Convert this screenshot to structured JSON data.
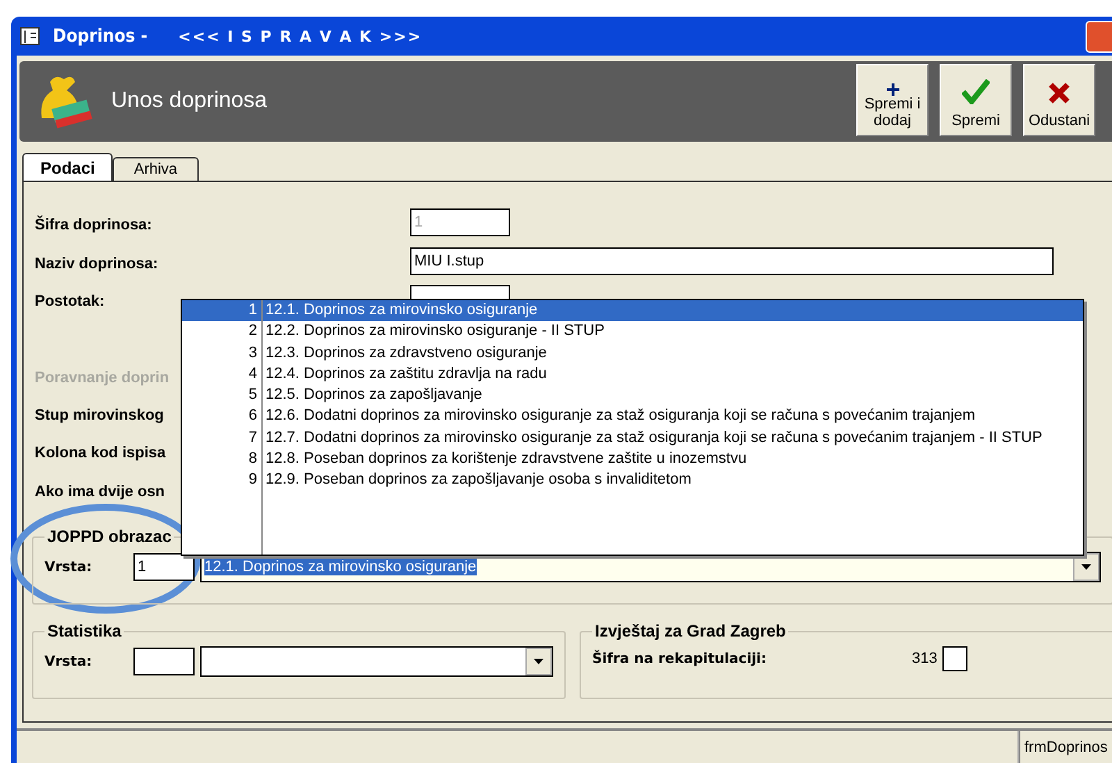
{
  "window": {
    "title": "Doprinos -",
    "mode": "<<< I S P R A V A K >>>"
  },
  "header": {
    "title": "Unos doprinosa"
  },
  "toolbar": [
    {
      "kind": "add",
      "label": "Spremi i",
      "label2": "dodaj"
    },
    {
      "kind": "save",
      "label": "Spremi"
    },
    {
      "kind": "cancel",
      "label": "Odustani"
    }
  ],
  "tabs": [
    {
      "label": "Podaci",
      "selected": true
    },
    {
      "label": "Arhiva",
      "selected": false
    }
  ],
  "fields": [
    {
      "label": "Šifra doprinosa:",
      "kind": "short",
      "value": "1",
      "disabled": true
    },
    {
      "label": "Naziv doprinosa:",
      "kind": "long",
      "value": "MIU I.stup",
      "disabled": false
    },
    {
      "label": "Postotak:",
      "kind": "short"
    },
    {
      "label": "Poravnanje doprin",
      "kind": "label",
      "disabled": true
    },
    {
      "label": "Stup mirovinskog",
      "kind": "label",
      "disabled": false
    },
    {
      "label": "Kolona kod ispisa",
      "kind": "label",
      "disabled": false
    },
    {
      "label": "Ako ima dvije osn",
      "kind": "label",
      "disabled": false
    }
  ],
  "dropdown_list": [
    {
      "number": "1",
      "text": "12.1. Doprinos za mirovinsko osiguranje",
      "selected": true
    },
    {
      "number": "2",
      "text": "12.2. Doprinos za mirovinsko osiguranje - II STUP",
      "selected": false
    },
    {
      "number": "3",
      "text": "12.3. Doprinos za zdravstveno osiguranje",
      "selected": false
    },
    {
      "number": "4",
      "text": "12.4. Doprinos za zaštitu zdravlja na radu",
      "selected": false
    },
    {
      "number": "5",
      "text": "12.5. Doprinos za zapošljavanje",
      "selected": false
    },
    {
      "number": "6",
      "text": "12.6. Dodatni doprinos za mirovinsko osiguranje za staž osiguranja koji se računa s povećanim trajanjem",
      "selected": false
    },
    {
      "number": "7",
      "text": "12.7. Dodatni doprinos za mirovinsko osiguranje za staž osiguranja koji se računa s povećanim trajanjem - II STUP",
      "selected": false
    },
    {
      "number": "8",
      "text": "12.8. Poseban doprinos za korištenje zdravstvene zaštite u inozemstvu",
      "selected": false
    },
    {
      "number": "9",
      "text": "12.9. Poseban doprinos za zapošljavanje osoba s invaliditetom",
      "selected": false
    }
  ],
  "joppd": {
    "title": "JOPPD obrazac",
    "label": "Vrsta:",
    "code": "1",
    "value": "12.1. Doprinos za mirovinsko osiguranje"
  },
  "statistika": {
    "title": "Statistika",
    "label": "Vrsta:"
  },
  "izvjestaj": {
    "title": "Izvještaj za Grad Zagreb",
    "label": "Šifra na rekapitulaciji:",
    "code": "313",
    "checked": false
  },
  "status_bar": {
    "form": "frmDoprinos"
  }
}
